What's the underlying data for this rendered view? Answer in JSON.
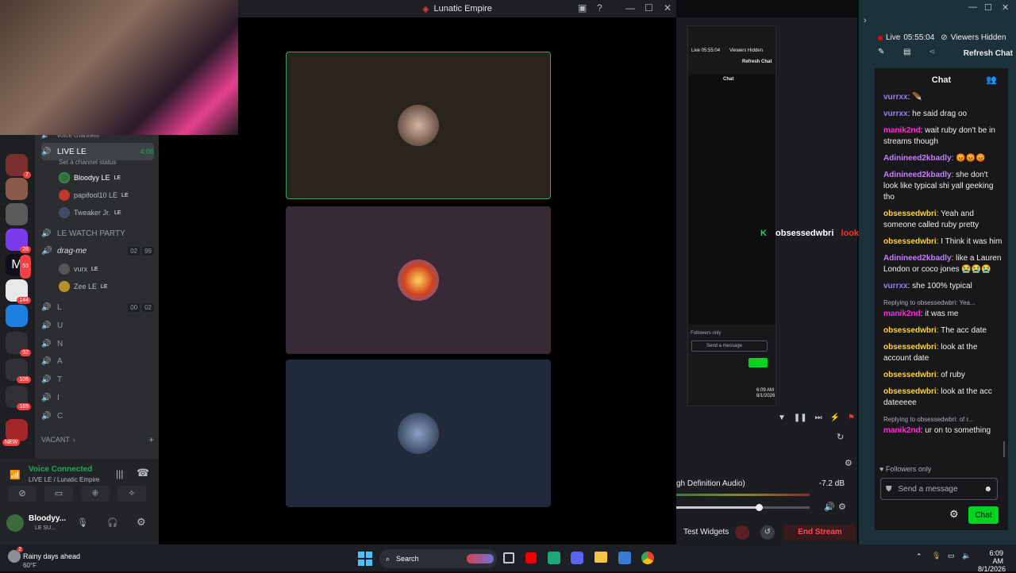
{
  "discord": {
    "window_title": "Lunatic Empire",
    "voice_channels_header": "voice channels",
    "live_channel": {
      "name": "LIVE LE",
      "timer": "4:06",
      "status": "Set a channel status"
    },
    "live_members": [
      {
        "name": "Bloodyy LE",
        "tag": "LE"
      },
      {
        "name": "papifool10 LE",
        "tag": "LE"
      },
      {
        "name": "Tweaker Jr.",
        "tag": "LE"
      }
    ],
    "watch_party": "LE WATCH PARTY",
    "drag_channel": {
      "name": "drag-me",
      "count_a": "02",
      "count_b": "99"
    },
    "drag_members": [
      {
        "name": "vurx",
        "tag": "LE"
      },
      {
        "name": "Zee LE",
        "tag": "LE"
      }
    ],
    "letter_channels": [
      {
        "name": "L",
        "count_a": "00",
        "count_b": "02"
      },
      {
        "name": "U"
      },
      {
        "name": "N"
      },
      {
        "name": "A"
      },
      {
        "name": "T"
      },
      {
        "name": "I"
      },
      {
        "name": "C"
      }
    ],
    "vacant": "VACANT",
    "server_badges": [
      "7",
      "28",
      "53",
      "144",
      "92",
      "106",
      "169",
      "NEW"
    ],
    "voice_connected": "Voice Connected",
    "voice_location": "LIVE LE / Lunatic Empire",
    "user": {
      "name": "Bloodyy...",
      "sub": "LE SU..."
    }
  },
  "obs": {
    "audio_source": "gh Definition Audio)",
    "audio_level": "-7.2 dB",
    "audio_fill": 0.62,
    "test_widgets": "Test Widgets",
    "end_stream": "End Stream",
    "mini_live": "Live 05:55:04",
    "mini_viewers": "Viewers Hidden",
    "mini_refresh": "Refresh Chat",
    "mini_chat": "Chat",
    "mini_followers": "Followers only",
    "mini_send": "Send a message",
    "mini_time": "6:09 AM",
    "mini_date": "8/1/2026"
  },
  "overlay": {
    "user": "obsessedwbri",
    "text": "look at the acc dateeeee",
    "user_color": "#ffffff",
    "text_color": "#ff2a2a"
  },
  "stream": {
    "live_label": "Live",
    "live_time": "05:55:04",
    "viewers": "Viewers Hidden",
    "refresh_chat": "Refresh Chat",
    "chat_title": "Chat",
    "followers_only": "Followers only",
    "send_placeholder": "Send a message",
    "chat_button": "Chat"
  },
  "messages": [
    {
      "user": "vurrxx",
      "color": "#9b7cf8",
      "text": "🪶"
    },
    {
      "user": "vurrxx",
      "color": "#9b7cf8",
      "text": "he said drag oo"
    },
    {
      "user": "manik2nd",
      "color": "#ff2bd6",
      "text": "wait ruby don't be in streams though"
    },
    {
      "user": "Adinineed2kbadly",
      "color": "#c77dff",
      "text": "😡😡😡"
    },
    {
      "user": "Adinineed2kbadly",
      "color": "#c77dff",
      "text": "she don't look like typical shi yall geeking tho"
    },
    {
      "user": "obsessedwbri",
      "color": "#ffd43b",
      "text": "Yeah and someone called ruby pretty"
    },
    {
      "user": "obsessedwbri",
      "color": "#ffd43b",
      "text": "I Think it was him"
    },
    {
      "user": "Adinineed2kbadly",
      "color": "#c77dff",
      "text": "like a Lauren London or coco jones 😭😭😭"
    },
    {
      "user": "vurrxx",
      "color": "#9b7cf8",
      "text": "she 100% typical"
    },
    {
      "reply": "Replying to obsessedwbri: Yea...",
      "user": "manik2nd",
      "color": "#ff2bd6",
      "text": "it was me"
    },
    {
      "user": "obsessedwbri",
      "color": "#ffd43b",
      "text": "The acc date"
    },
    {
      "user": "obsessedwbri",
      "color": "#ffd43b",
      "text": "look at the account date"
    },
    {
      "user": "obsessedwbri",
      "color": "#ffd43b",
      "text": "of ruby"
    },
    {
      "user": "obsessedwbri",
      "color": "#ffd43b",
      "text": "look at the acc dateeeee"
    },
    {
      "reply": "Replying to obsessedwbri: of r...",
      "user": "manik2nd",
      "color": "#ff2bd6",
      "text": "ur on to something"
    }
  ],
  "taskbar": {
    "weather_title": "Rainy days ahead",
    "weather_temp": "60°F",
    "weather_badge": "2",
    "search": "Search",
    "time": "6:09 AM",
    "date": "8/1/2026"
  },
  "colors": {
    "accent_green": "#00d420",
    "live_red": "#eb0400",
    "discord_green": "#23a55a"
  }
}
